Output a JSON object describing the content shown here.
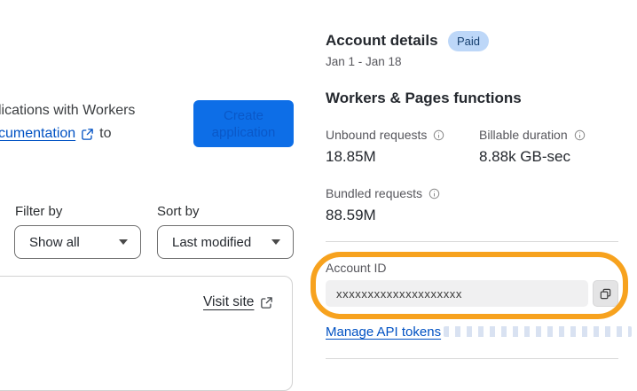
{
  "left": {
    "intro_line1": "lications with Workers",
    "intro_link_text": "cumentation",
    "intro_after_link": "to",
    "create_button_label": "Create application",
    "filter_label": "Filter by",
    "filter_value": "Show all",
    "sort_label": "Sort by",
    "sort_value": "Last modified",
    "visit_site_label": "Visit site"
  },
  "account": {
    "title": "Account details",
    "plan_badge": "Paid",
    "date_range": "Jan 1 - Jan 18",
    "section_title": "Workers & Pages functions",
    "metrics": [
      {
        "label": "Unbound requests",
        "value": "18.85M"
      },
      {
        "label": "Billable duration",
        "value": "8.88k GB-sec"
      },
      {
        "label": "Bundled requests",
        "value": "88.59M"
      }
    ],
    "account_id_label": "Account ID",
    "account_id_value": "xxxxxxxxxxxxxxxxxxxx",
    "manage_link_label": "Manage API tokens"
  },
  "colors": {
    "button_blue": "#0d6ee7",
    "link_blue": "#0051c3",
    "badge_bg": "#bdd7f8",
    "badge_text": "#17406f",
    "highlight_orange": "#f7a21e"
  }
}
